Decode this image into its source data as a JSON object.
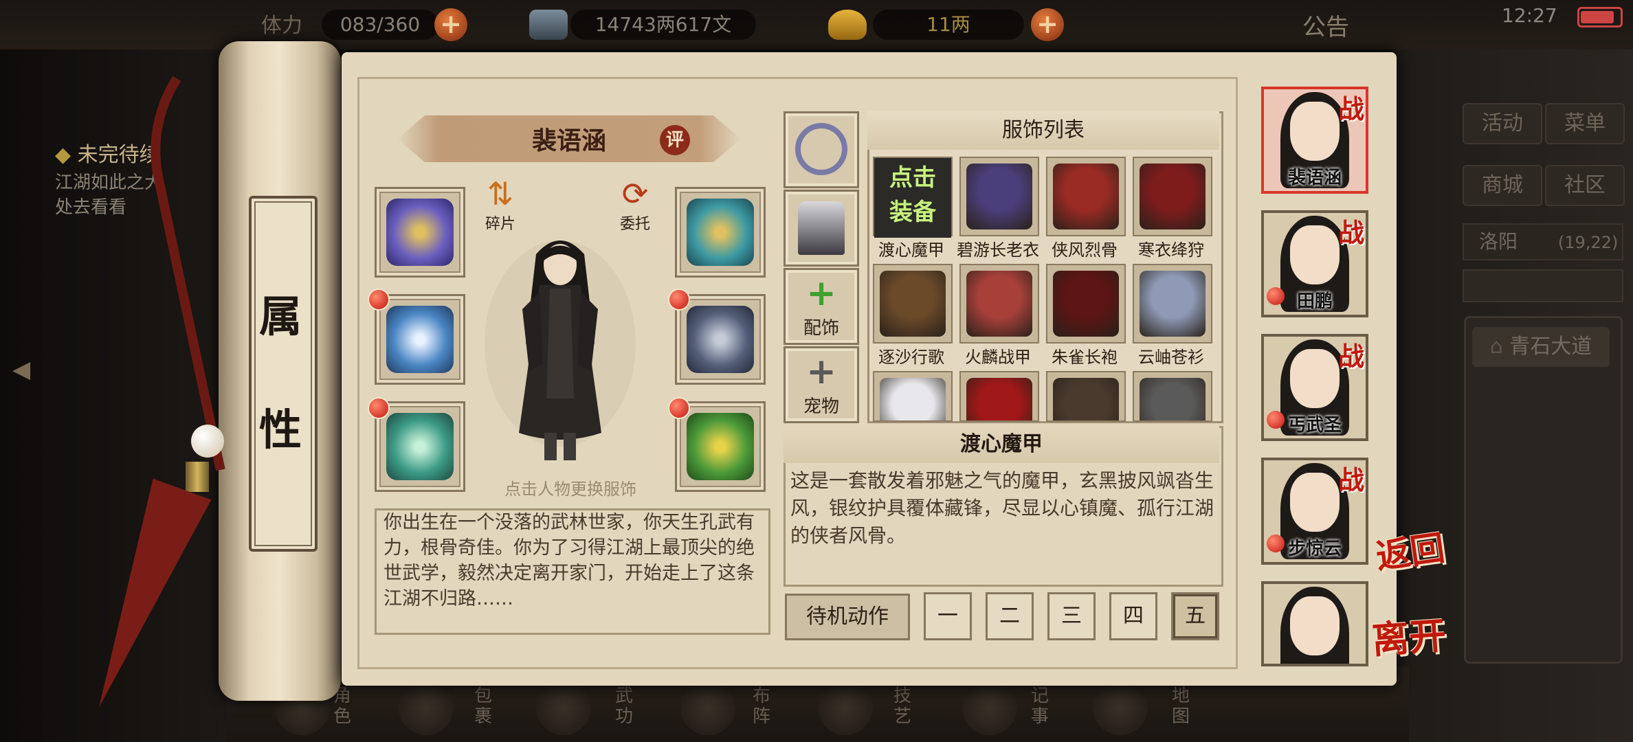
{
  "topbar": {
    "stamina_label": "体力",
    "stamina_value": "083/360",
    "silver": "14743两617文",
    "gold": "11两",
    "announcement": "公告",
    "time": "12:27"
  },
  "quest": {
    "title": "未完待续",
    "lines": [
      "江湖如此之大",
      "处去看看"
    ]
  },
  "right_menu": {
    "buttons": [
      "活动",
      "菜单",
      "商城",
      "社区"
    ],
    "location_name": "洛阳",
    "location_coords": "(19,22)",
    "route": "青石大道"
  },
  "bottom_nav": [
    "角色",
    "包裹",
    "武功",
    "布阵",
    "技艺",
    "记事",
    "地图"
  ],
  "scroll_tab": {
    "chars": [
      "属",
      "性"
    ]
  },
  "character": {
    "name": "裴语涵",
    "eval_badge": "评",
    "fragments_label": "碎片",
    "entrust_label": "委托",
    "hint": "点击人物更换服饰",
    "bio": "你出生在一个没落的武林世家，你天生孔武有力，根骨奇佳。你为了习得江湖上最顶尖的绝世武学，毅然决定离开家门，开始走上了这条江湖不归路……"
  },
  "equipment": {
    "left": [
      {
        "icon": "gauntlet-icon",
        "color": "#6a5fc0",
        "alert": false
      },
      {
        "icon": "bracer-icon",
        "color": "#4b86c4",
        "alert": true
      },
      {
        "icon": "ring-icon",
        "color": "#3c9a86",
        "alert": true
      }
    ],
    "right": [
      {
        "icon": "hat-icon",
        "color": "#3d9aa4",
        "alert": false
      },
      {
        "icon": "armor-icon",
        "color": "#56607a",
        "alert": true
      },
      {
        "icon": "amulet-icon",
        "color": "#4c9a3a",
        "alert": true
      }
    ]
  },
  "mid_column": {
    "accessory_label": "配饰",
    "pet_label": "宠物"
  },
  "outfit_list": {
    "title": "服饰列表",
    "equip_line1": "点击",
    "equip_line2": "装备",
    "items": [
      {
        "name": "渡心魔甲",
        "color": "#2a2a2a"
      },
      {
        "name": "碧游长老衣",
        "color": "#4a3f7a"
      },
      {
        "name": "侠风烈骨",
        "color": "#9a2a24"
      },
      {
        "name": "寒衣绛狩",
        "color": "#7e1c1c"
      },
      {
        "name": "逐沙行歌",
        "color": "#6b4a2a"
      },
      {
        "name": "火麟战甲",
        "color": "#a8403a"
      },
      {
        "name": "朱雀长袍",
        "color": "#5c1414"
      },
      {
        "name": "云岫苍衫",
        "color": "#8e9ab6"
      },
      {
        "name": "",
        "color": "#e8e8ec"
      },
      {
        "name": "",
        "color": "#a01818"
      },
      {
        "name": "",
        "color": "#4a3a2e"
      },
      {
        "name": "",
        "color": "#5a5a5a"
      }
    ]
  },
  "description": {
    "title": "渡心魔甲",
    "text": "这是一套散发着邪魅之气的魔甲，玄黑披风飒沓生风，银纹护具覆体藏锋，尽显以心镇魔、孤行江湖的侠者风骨。"
  },
  "idle": {
    "label": "待机动作",
    "options": [
      "一",
      "二",
      "三",
      "四",
      "五"
    ],
    "selected": "五"
  },
  "team": [
    {
      "name": "裴语涵",
      "battle": "战",
      "selected": true,
      "alert": false
    },
    {
      "name": "田鹏",
      "battle": "战",
      "selected": false,
      "alert": true
    },
    {
      "name": "丐武圣",
      "battle": "战",
      "selected": false,
      "alert": true
    },
    {
      "name": "步惊云",
      "battle": "战",
      "selected": false,
      "alert": true
    },
    {
      "name": "",
      "battle": "",
      "selected": false,
      "alert": false
    }
  ],
  "actions": {
    "back": "返回",
    "leave": "离开"
  }
}
